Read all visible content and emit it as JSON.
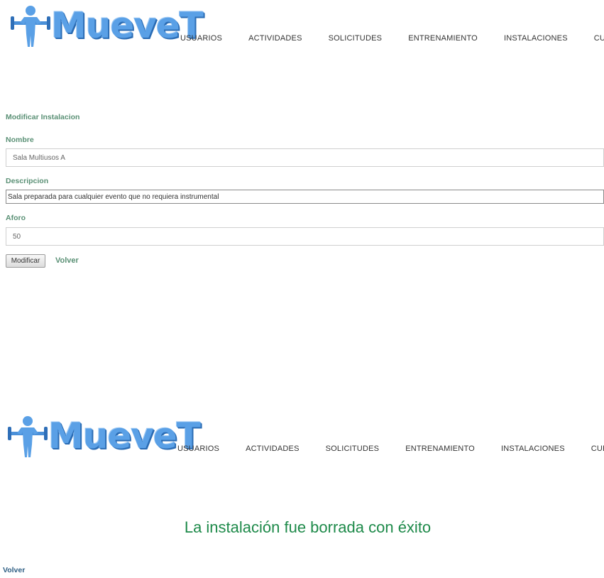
{
  "brand": {
    "name": "MueveT",
    "logo_icon": "weightlifter-icon",
    "color": "#5aa0e6"
  },
  "nav": {
    "items": [
      "USUARIOS",
      "ACTIVIDADES",
      "SOLICITUDES",
      "ENTRENAMIENTO",
      "INSTALACIONES",
      "CUENTA"
    ]
  },
  "form": {
    "title": "Modificar Instalacion",
    "nombre_label": "Nombre",
    "nombre_value": "Sala Multiusos A",
    "descripcion_label": "Descripcion",
    "descripcion_value": "Sala preparada para cualquier evento que no requiera instrumental",
    "aforo_label": "Aforo",
    "aforo_value": "50",
    "submit_label": "Modificar",
    "back_label": "Volver"
  },
  "result": {
    "message": "La instalación fue borrada con éxito",
    "back_label": "Volver"
  },
  "colors": {
    "label_green": "#5a9075",
    "success_green": "#1e8a4a",
    "back_blue": "#2f5f84"
  }
}
